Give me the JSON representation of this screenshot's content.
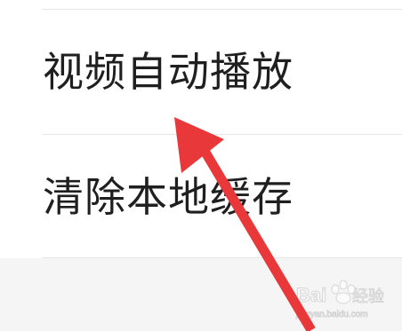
{
  "settings": {
    "items": [
      {
        "label": "视频自动播放"
      },
      {
        "label": "清除本地缓存"
      }
    ]
  },
  "watermark": {
    "line1": "Bai",
    "line2": "经验",
    "line3": "jingyan.baidu.com"
  },
  "colors": {
    "arrow": "#e8383a",
    "text": "#1f1f1f",
    "divider": "#e6e6e6",
    "bottom_bg": "#f5f5f5"
  }
}
